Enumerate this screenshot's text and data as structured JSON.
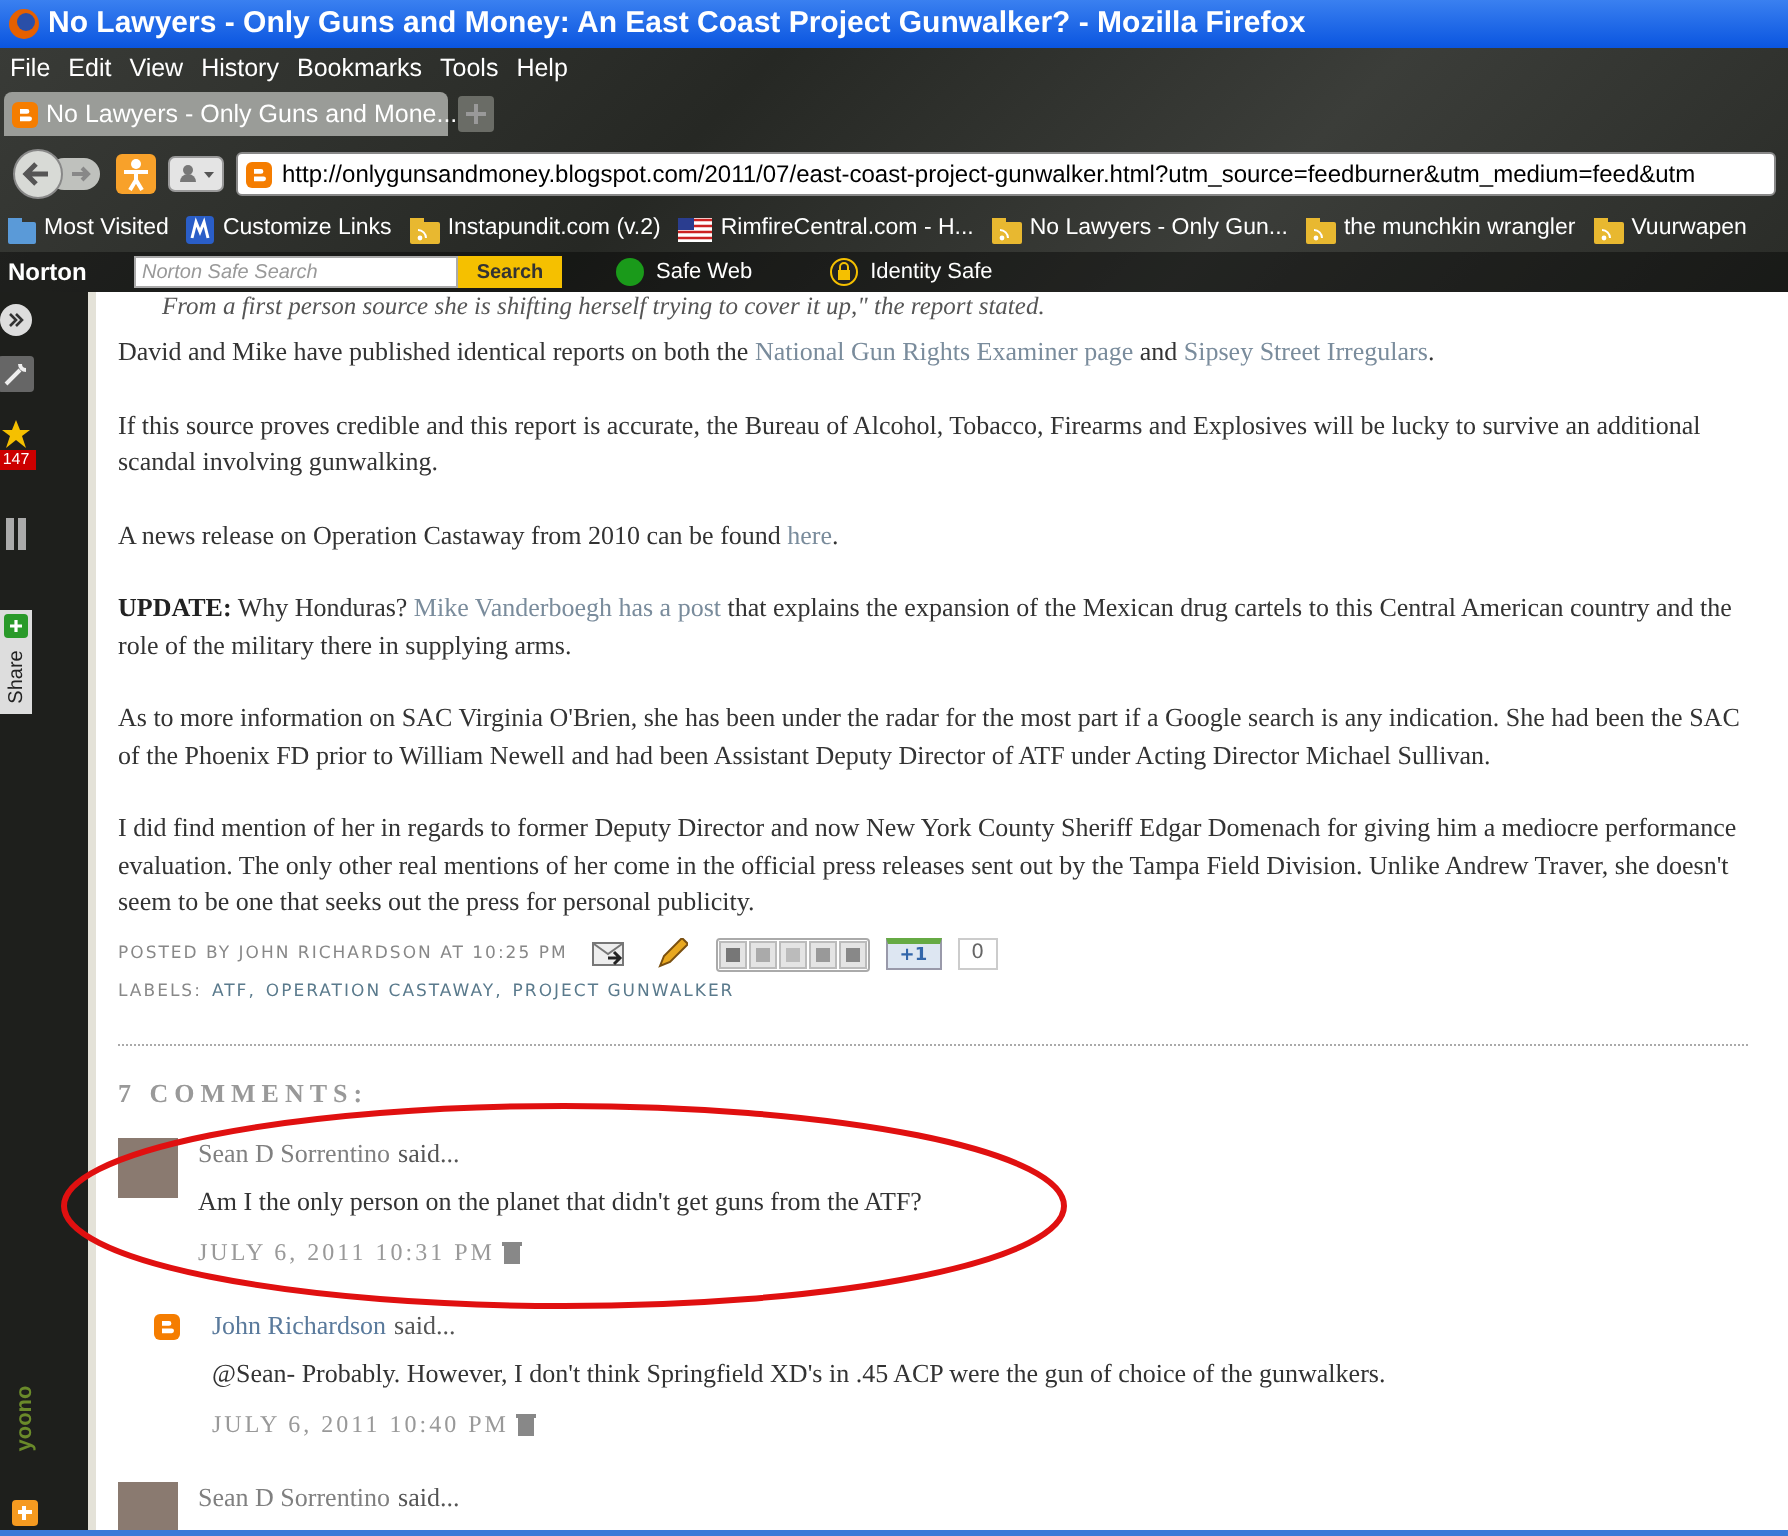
{
  "window": {
    "title": "No Lawyers - Only Guns and Money: An East Coast Project Gunwalker? - Mozilla Firefox"
  },
  "menu": [
    "File",
    "Edit",
    "View",
    "History",
    "Bookmarks",
    "Tools",
    "Help"
  ],
  "tabs": [
    {
      "label": "No Lawyers - Only Guns and Mone...",
      "selected": true
    }
  ],
  "address": {
    "url": "http://onlygunsandmoney.blogspot.com/2011/07/east-coast-project-gunwalker.html?utm_source=feedburner&utm_medium=feed&utm"
  },
  "bookmarks": [
    {
      "label": "Most Visited",
      "kind": "star"
    },
    {
      "label": "Customize Links",
      "kind": "m"
    },
    {
      "label": "Instapundit.com (v.2)",
      "kind": "feed"
    },
    {
      "label": "RimfireCentral.com - H...",
      "kind": "flag"
    },
    {
      "label": "No Lawyers - Only Gun...",
      "kind": "feed"
    },
    {
      "label": "the munchkin wrangler",
      "kind": "feed"
    },
    {
      "label": "Vuurwapen",
      "kind": "feed"
    }
  ],
  "norton": {
    "brand": "Norton",
    "search_placeholder": "Norton Safe Search",
    "search_button": "Search",
    "safe_web": "Safe Web",
    "identity_safe": "Identity Safe"
  },
  "sidebar": {
    "badge": "147",
    "share": "Share",
    "logo": "yoono"
  },
  "article": {
    "cut_line": "From a first person source she is shifting herself trying to cover it up,\" the report stated.",
    "paragraphs": [
      [
        {
          "kind": "text",
          "text": "David and Mike have published identical reports on both the "
        },
        {
          "kind": "link",
          "text": "National Gun Rights Examiner page"
        },
        {
          "kind": "text",
          "text": " and "
        },
        {
          "kind": "link",
          "text": "Sipsey Street Irregulars"
        },
        {
          "kind": "text",
          "text": "."
        }
      ],
      [
        {
          "kind": "text",
          "text": "If this source proves credible and this report is accurate, the Bureau of Alcohol, Tobacco, Firearms and Explosives will be lucky to survive an additional scandal involving gunwalking."
        }
      ],
      [
        {
          "kind": "text",
          "text": "A news release on Operation Castaway from 2010 can be found "
        },
        {
          "kind": "link",
          "text": "here"
        },
        {
          "kind": "text",
          "text": "."
        }
      ],
      [
        {
          "kind": "bold",
          "text": "UPDATE:"
        },
        {
          "kind": "text",
          "text": " Why Honduras? "
        },
        {
          "kind": "link",
          "text": "Mike Vanderboegh has a post"
        },
        {
          "kind": "text",
          "text": " that explains the expansion of the Mexican drug cartels to this Central American country and the role of the military there in supplying arms."
        }
      ],
      [
        {
          "kind": "text",
          "text": "As to more information on SAC Virginia O'Brien, she has been under the radar for the most part if a Google search is any indication. She had been the SAC of the Phoenix FD prior to William Newell and had been Assistant Deputy Director of ATF under Acting Director Michael Sullivan."
        }
      ],
      [
        {
          "kind": "text",
          "text": "I did find mention of her in regards to former Deputy Director and now New York County Sheriff Edgar Domenach for giving him a mediocre performance evaluation. The only other real mentions of her come in the official press releases sent out by the Tampa Field Division. Unlike Andrew Traver, she doesn't seem to be one that seeks out the press for personal publicity."
        }
      ]
    ],
    "posted_by": "POSTED BY JOHN RICHARDSON AT 10:25 PM",
    "plus_one": "+1",
    "plus_count": "0",
    "labels_prefix": "LABELS:",
    "labels": [
      "ATF,",
      "OPERATION CASTAWAY,",
      "PROJECT GUNWALKER"
    ]
  },
  "comments": {
    "heading": "7 COMMENTS:",
    "items": [
      {
        "author": "Sean D Sorrentino",
        "said": "said...",
        "kind": "photo",
        "reply": false,
        "text": "Am I the only person on the planet that didn't get guns from the ATF?",
        "time": "JULY 6, 2011 10:31 PM"
      },
      {
        "author": "John Richardson",
        "said": "said...",
        "kind": "blogger",
        "reply": true,
        "text": "@Sean- Probably. However, I don't think Springfield XD's in .45 ACP were the gun of choice of the gunwalkers.",
        "time": "JULY 6, 2011 10:40 PM"
      },
      {
        "author": "Sean D Sorrentino",
        "said": "said...",
        "kind": "photo",
        "reply": false
      }
    ]
  }
}
